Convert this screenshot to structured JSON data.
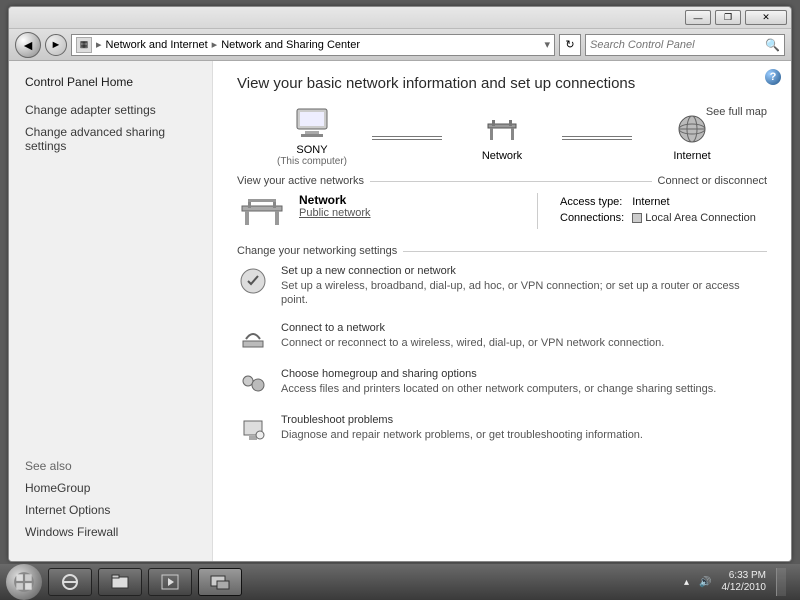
{
  "titlebar": {
    "min": "—",
    "max": "❐",
    "close": "✕"
  },
  "nav": {
    "back": "◄",
    "fwd": "►",
    "refresh": "↻",
    "crumb1": "Network and Internet",
    "crumb2": "Network and Sharing Center",
    "search_placeholder": "Search Control Panel"
  },
  "sidebar": {
    "home": "Control Panel Home",
    "link1": "Change adapter settings",
    "link2": "Change advanced sharing settings",
    "seealso": "See also",
    "sa1": "HomeGroup",
    "sa2": "Internet Options",
    "sa3": "Windows Firewall"
  },
  "main": {
    "heading": "View your basic network information and set up connections",
    "fullmap": "See full map",
    "node_pc": "SONY",
    "node_pc_sub": "(This computer)",
    "node_net": "Network",
    "node_inet": "Internet",
    "active_label": "View your active networks",
    "connect_link": "Connect or disconnect",
    "net_name": "Network",
    "net_type": "Public network",
    "access_label": "Access type:",
    "access_val": "Internet",
    "conn_label": "Connections:",
    "conn_val": "Local Area Connection",
    "change_label": "Change your networking settings",
    "tasks": [
      {
        "title": "Set up a new connection or network",
        "desc": "Set up a wireless, broadband, dial-up, ad hoc, or VPN connection; or set up a router or access point."
      },
      {
        "title": "Connect to a network",
        "desc": "Connect or reconnect to a wireless, wired, dial-up, or VPN network connection."
      },
      {
        "title": "Choose homegroup and sharing options",
        "desc": "Access files and printers located on other network computers, or change sharing settings."
      },
      {
        "title": "Troubleshoot problems",
        "desc": "Diagnose and repair network problems, or get troubleshooting information."
      }
    ]
  },
  "tray": {
    "time": "6:33 PM",
    "date": "4/12/2010"
  }
}
